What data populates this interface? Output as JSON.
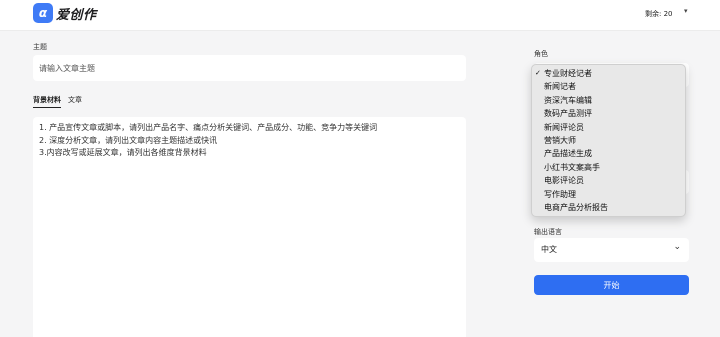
{
  "header": {
    "logo_glyph": "α",
    "logo_text": "爱创作",
    "remaining": "剩余: 20",
    "remaining_caret": "▾"
  },
  "topic": {
    "label": "主题",
    "placeholder": "请输入文章主题",
    "value": ""
  },
  "tabs": [
    {
      "label": "背景材料",
      "active": true
    },
    {
      "label": "文章",
      "active": false
    }
  ],
  "material": {
    "lines": [
      "1. 产品宣传文章或脚本，请列出产品名字、痛点分析关键词、产品成分、功能、竞争力等关键词",
      "2. 深度分析文章，请列出文章内容主题描述或快讯",
      "3.内容改写或延展文章，请列出各维度背景材料"
    ]
  },
  "role": {
    "label": "角色",
    "selected": "专业财经记者",
    "check": "✓",
    "options": [
      "专业财经记者",
      "新闻记者",
      "资深汽车编辑",
      "数码产品测评",
      "新闻评论员",
      "营销大师",
      "产品描述生成",
      "小红书文案高手",
      "电影评论员",
      "写作助理",
      "电商产品分析报告"
    ]
  },
  "output_language": {
    "label": "输出语言",
    "value": "中文",
    "chevron": "⌄"
  },
  "start_button": {
    "label": "开始"
  },
  "colors": {
    "accent": "#2e6ef2",
    "logo_bg": "#3f7bf6",
    "page_bg": "#f5f5f6"
  }
}
